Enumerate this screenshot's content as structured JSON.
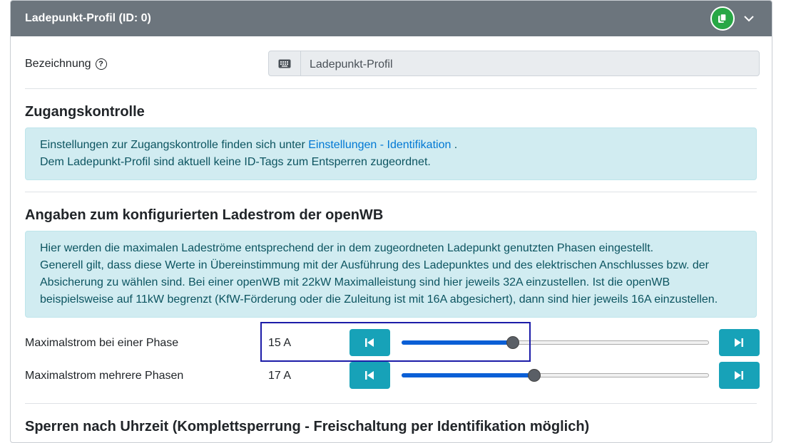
{
  "header": {
    "title": "Ladepunkt-Profil (ID: 0)",
    "copy_icon": "copy-icon",
    "chevron_icon": "chevron-down-icon"
  },
  "designation": {
    "label": "Bezeichnung",
    "help_icon": "?",
    "input_icon": "keyboard-icon",
    "value": "Ladepunkt-Profil"
  },
  "access_control": {
    "title": "Zugangskontrolle",
    "line1_prefix": "Einstellungen zur Zugangskontrolle finden sich unter ",
    "line1_link": "Einstellungen - Identifikation",
    "line1_suffix": " .",
    "line2": "Dem Ladepunkt-Profil sind aktuell keine ID-Tags zum Entsperren zugeordnet."
  },
  "current_config": {
    "title": "Angaben zum konfigurierten Ladestrom der openWB",
    "info_lines": [
      "Hier werden die maximalen Ladeströme entsprechend der in dem zugeordneten Ladepunkt genutzten Phasen eingestellt.",
      "Generell gilt, dass diese Werte in Übereinstimmung mit der Ausführung des Ladepunktes und des elektrischen Anschlusses bzw. der",
      "Absicherung zu wählen sind. Bei einer openWB mit 22kW Maximalleistung sind hier jeweils 32A einzustellen. Ist die openWB",
      "beispielsweise auf 11kW begrenzt (KfW-Förderung oder die Zuleitung ist mit 16A abgesichert), dann sind hier jeweils 16A einzustellen."
    ],
    "sliders": [
      {
        "label": "Maximalstrom bei einer Phase",
        "value_text": "15 A",
        "fraction": 0.36
      },
      {
        "label": "Maximalstrom mehrere Phasen",
        "value_text": "17 A",
        "fraction": 0.43
      }
    ],
    "decrement_icon": "skip-back-icon",
    "increment_icon": "skip-forward-icon"
  },
  "time_lock": {
    "title": "Sperren nach Uhrzeit (Komplettsperrung - Freischaltung per Identifikation möglich)"
  }
}
